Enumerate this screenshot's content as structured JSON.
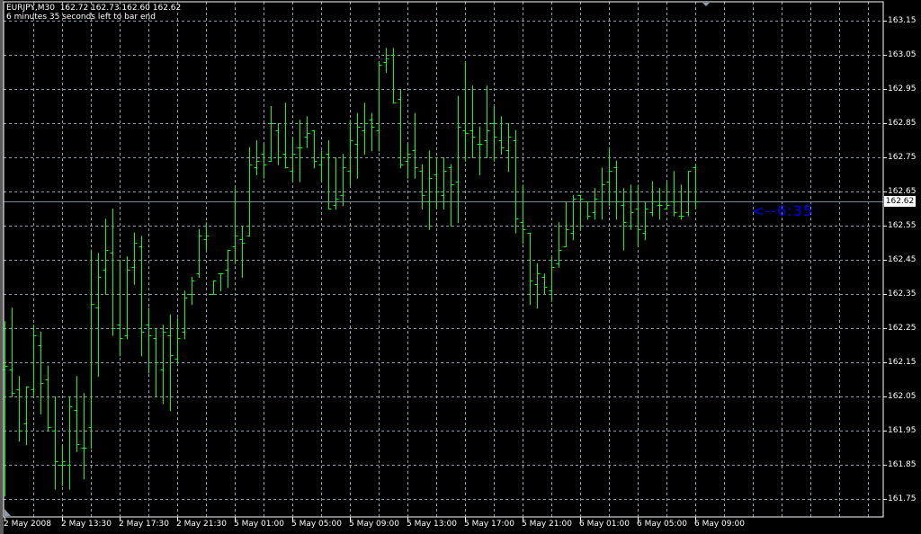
{
  "header": {
    "symbol_line": "EURJPY,M30  162.72 162.73 162.60 162.62",
    "timer_line": "6 minutes 35 seconds left to bar end"
  },
  "countdown": "<--6:35",
  "current_price": "162.62",
  "colors": {
    "background": "#000000",
    "bars": "#00ff00",
    "grid": "#8a9bb0",
    "price_line": "#778899",
    "countdown": "#0000ff",
    "axis": "#ffffff"
  },
  "chart_data": {
    "type": "ohlc",
    "symbol": "EURJPY",
    "timeframe": "M30",
    "ylim": [
      161.75,
      163.15
    ],
    "y_ticks": [
      "163.15",
      "163.05",
      "162.95",
      "162.85",
      "162.75",
      "162.65",
      "162.55",
      "162.45",
      "162.35",
      "162.25",
      "162.15",
      "162.05",
      "161.95",
      "161.85",
      "161.75"
    ],
    "x_labels": [
      "2 May 2008",
      "2 May 13:30",
      "2 May 17:30",
      "2 May 21:30",
      "5 May 01:00",
      "5 May 05:00",
      "5 May 09:00",
      "5 May 13:00",
      "5 May 17:00",
      "5 May 21:00",
      "6 May 01:00",
      "6 May 05:00",
      "6 May 09:00"
    ],
    "bars_per_label": 8,
    "current_price": 162.62,
    "ohlc": [
      [
        162.13,
        162.27,
        161.76,
        162.14
      ],
      [
        162.13,
        162.31,
        162.05,
        162.06
      ],
      [
        162.07,
        162.11,
        161.92,
        161.95
      ],
      [
        161.97,
        162.08,
        161.91,
        162.08
      ],
      [
        162.07,
        162.26,
        162.05,
        162.23
      ],
      [
        162.2,
        162.24,
        162.0,
        162.09
      ],
      [
        162.1,
        162.14,
        161.95,
        161.96
      ],
      [
        161.95,
        162.05,
        161.78,
        161.86
      ],
      [
        161.85,
        161.91,
        161.79,
        161.86
      ],
      [
        161.85,
        162.05,
        161.78,
        162.02
      ],
      [
        162.01,
        162.11,
        161.89,
        161.91
      ],
      [
        161.9,
        162.06,
        161.81,
        161.9
      ],
      [
        161.96,
        162.48,
        161.9,
        162.32
      ],
      [
        162.31,
        162.47,
        162.11,
        162.4
      ],
      [
        162.42,
        162.57,
        162.35,
        162.48
      ],
      [
        162.47,
        162.6,
        162.23,
        162.25
      ],
      [
        162.26,
        162.45,
        162.17,
        162.22
      ],
      [
        162.23,
        162.46,
        162.22,
        162.42
      ],
      [
        162.43,
        162.53,
        162.38,
        162.5
      ],
      [
        162.49,
        162.52,
        162.17,
        162.24
      ],
      [
        162.26,
        162.31,
        162.12,
        162.23
      ],
      [
        162.22,
        162.25,
        162.05,
        162.15
      ],
      [
        162.13,
        162.26,
        162.03,
        162.24
      ],
      [
        162.23,
        162.29,
        162.01,
        162.17
      ],
      [
        162.16,
        162.28,
        162.15,
        162.22
      ],
      [
        162.24,
        162.36,
        162.22,
        162.34
      ],
      [
        162.35,
        162.4,
        162.32,
        162.39
      ],
      [
        162.41,
        162.54,
        162.4,
        162.52
      ],
      [
        162.51,
        162.56,
        162.48,
        162.52
      ],
      [
        162.35,
        162.39,
        162.35,
        162.39
      ],
      [
        162.41,
        162.41,
        162.36,
        162.41
      ],
      [
        162.42,
        162.48,
        162.37,
        162.48
      ],
      [
        162.49,
        162.66,
        162.44,
        162.52
      ],
      [
        162.51,
        162.55,
        162.4,
        162.5
      ],
      [
        162.52,
        162.78,
        162.52,
        162.73
      ],
      [
        162.72,
        162.8,
        162.7,
        162.74
      ],
      [
        162.76,
        162.79,
        162.69,
        162.73
      ],
      [
        162.74,
        162.9,
        162.74,
        162.85
      ],
      [
        162.83,
        162.85,
        162.73,
        162.75
      ],
      [
        162.76,
        162.91,
        162.72,
        162.72
      ],
      [
        162.71,
        162.81,
        162.68,
        162.76
      ],
      [
        162.78,
        162.86,
        162.68,
        162.78
      ],
      [
        162.81,
        162.87,
        162.78,
        162.82
      ],
      [
        162.83,
        162.83,
        162.72,
        162.74
      ],
      [
        162.73,
        162.77,
        162.68,
        162.75
      ],
      [
        162.76,
        162.8,
        162.6,
        162.6
      ],
      [
        162.61,
        162.75,
        162.6,
        162.63
      ],
      [
        162.64,
        162.76,
        162.61,
        162.72
      ],
      [
        162.71,
        162.86,
        162.67,
        162.8
      ],
      [
        162.79,
        162.88,
        162.69,
        162.84
      ],
      [
        162.83,
        162.91,
        162.76,
        162.85
      ],
      [
        162.86,
        162.88,
        162.77,
        162.84
      ],
      [
        162.83,
        163.03,
        162.77,
        163.02
      ],
      [
        163.03,
        163.07,
        163.0,
        163.04
      ],
      [
        163.05,
        163.07,
        162.91,
        162.91
      ],
      [
        162.92,
        162.95,
        162.72,
        162.73
      ],
      [
        162.74,
        162.79,
        162.69,
        162.76
      ],
      [
        162.77,
        162.88,
        162.69,
        162.72
      ],
      [
        162.71,
        162.73,
        162.6,
        162.64
      ],
      [
        162.62,
        162.77,
        162.54,
        162.69
      ],
      [
        162.7,
        162.75,
        162.6,
        162.65
      ],
      [
        162.64,
        162.75,
        162.6,
        162.71
      ],
      [
        162.72,
        162.73,
        162.55,
        162.67
      ],
      [
        162.68,
        162.93,
        162.56,
        162.84
      ],
      [
        162.83,
        163.03,
        162.74,
        162.82
      ],
      [
        162.83,
        162.96,
        162.75,
        162.81
      ],
      [
        162.79,
        162.84,
        162.7,
        162.79
      ],
      [
        162.8,
        162.96,
        162.75,
        162.83
      ],
      [
        162.85,
        162.9,
        162.74,
        162.81
      ],
      [
        162.8,
        162.87,
        162.76,
        162.78
      ],
      [
        162.77,
        162.85,
        162.71,
        162.81
      ],
      [
        162.8,
        162.83,
        162.53,
        162.57
      ],
      [
        162.56,
        162.67,
        162.5,
        162.54
      ],
      [
        162.53,
        162.53,
        162.32,
        162.39
      ],
      [
        162.38,
        162.44,
        162.31,
        162.41
      ],
      [
        162.4,
        162.41,
        162.35,
        162.37
      ],
      [
        162.36,
        162.46,
        162.33,
        162.43
      ],
      [
        162.44,
        162.56,
        162.43,
        162.48
      ],
      [
        162.49,
        162.62,
        162.49,
        162.54
      ],
      [
        162.53,
        162.64,
        162.51,
        162.63
      ],
      [
        162.64,
        162.64,
        162.54,
        162.63
      ],
      [
        162.62,
        162.62,
        162.57,
        162.58
      ],
      [
        162.59,
        162.66,
        162.57,
        162.63
      ],
      [
        162.62,
        162.72,
        162.57,
        162.67
      ],
      [
        162.68,
        162.78,
        162.61,
        162.71
      ],
      [
        162.72,
        162.74,
        162.57,
        162.62
      ],
      [
        162.61,
        162.66,
        162.48,
        162.56
      ],
      [
        162.55,
        162.67,
        162.54,
        162.59
      ],
      [
        162.6,
        162.67,
        162.49,
        162.54
      ],
      [
        162.53,
        162.62,
        162.51,
        162.6
      ],
      [
        162.59,
        162.68,
        162.58,
        162.62
      ],
      [
        162.61,
        162.66,
        162.57,
        162.61
      ],
      [
        162.6,
        162.68,
        162.6,
        162.61
      ],
      [
        162.62,
        162.71,
        162.58,
        162.59
      ],
      [
        162.58,
        162.67,
        162.57,
        162.58
      ],
      [
        162.59,
        162.71,
        162.58,
        162.71
      ],
      [
        162.72,
        162.73,
        162.6,
        162.62
      ]
    ]
  }
}
